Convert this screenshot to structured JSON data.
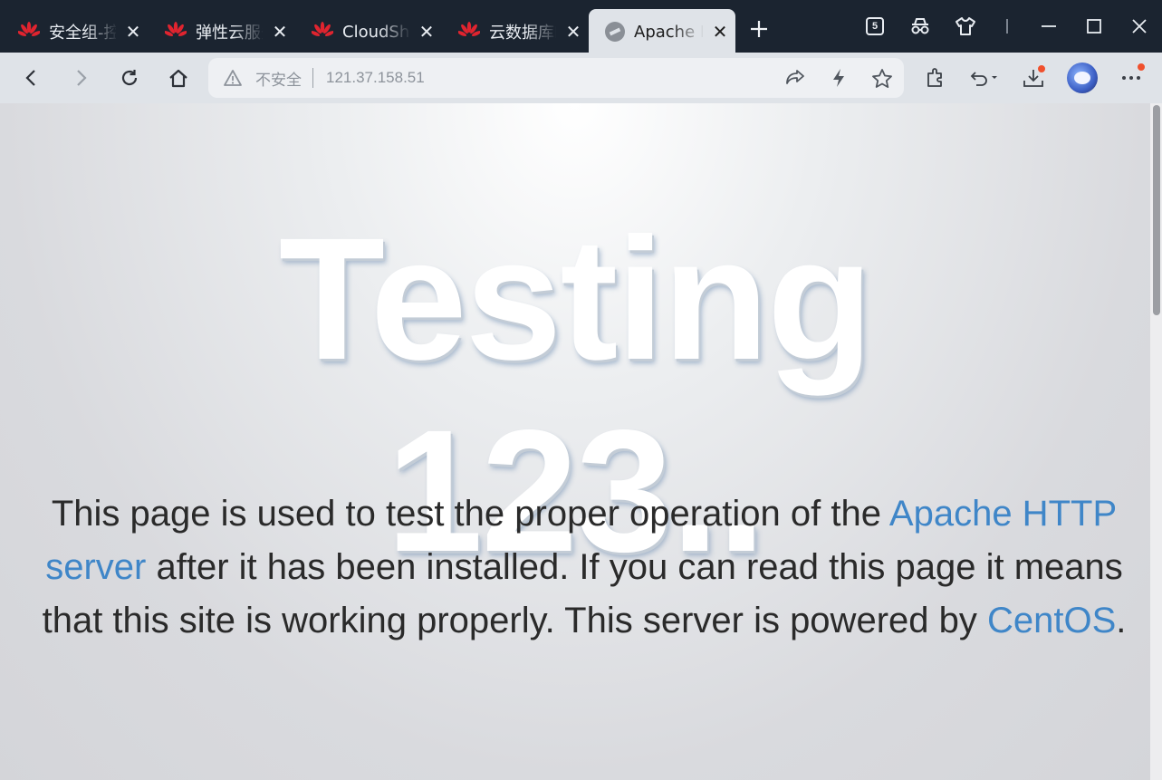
{
  "tabs": [
    {
      "title": "安全组-控",
      "icon": "huawei-logo",
      "active": false
    },
    {
      "title": "弹性云服务",
      "icon": "huawei-logo",
      "active": false
    },
    {
      "title": "CloudShell",
      "icon": "huawei-logo",
      "active": false
    },
    {
      "title": "云数据库R",
      "icon": "huawei-logo",
      "active": false
    },
    {
      "title": "Apache HTTP",
      "icon": "apache-logo",
      "active": true
    }
  ],
  "window_controls": {
    "tab_count_badge": "5"
  },
  "address_bar": {
    "security_label": "不安全",
    "url": "121.37.158.51"
  },
  "page": {
    "heading_line1": "Testing",
    "heading_line2": "123..",
    "para_text1": "This page is used to test the proper operation of the",
    "link_apache": "Apache HTTP server",
    "para_text2": " after it has been installed. If you can read this page it means that this site is working properly. This server is powered by ",
    "link_os": "CentOS",
    "para_text3": "."
  },
  "colors": {
    "tabbar_bg": "#1b2430",
    "toolbar_bg": "#dfe3e8",
    "link": "#3f86c8",
    "notification_dot": "#f0502d"
  }
}
